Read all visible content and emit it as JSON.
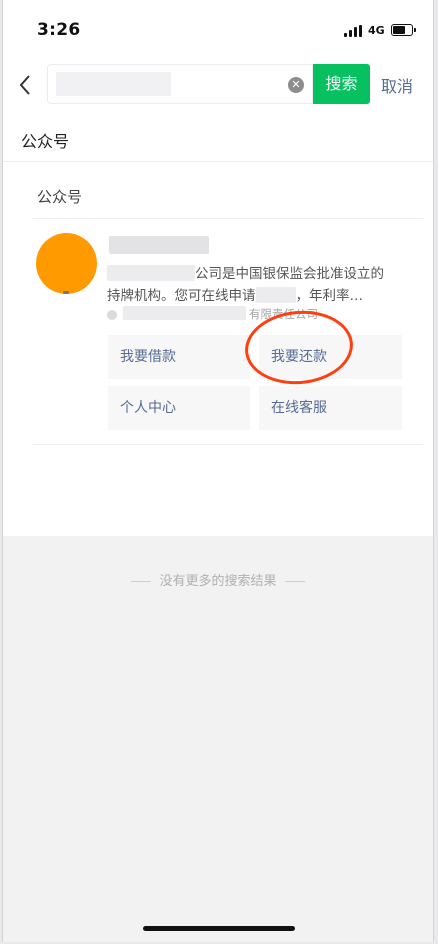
{
  "status_bar": {
    "time": "3:26",
    "network": "4G"
  },
  "search": {
    "button_label": "搜索",
    "cancel_label": "取消"
  },
  "section": {
    "label": "公众号",
    "group_title": "公众号"
  },
  "result": {
    "description_line1": "公司是中国银保监会批准设立的",
    "description_line2_part1": "持牌机构。您可在线申请",
    "description_line2_part2": "，年利率…",
    "meta_text": "有限责任公司",
    "menu": [
      {
        "label": "我要借款"
      },
      {
        "label": "我要还款"
      },
      {
        "label": "个人中心"
      },
      {
        "label": "在线客服"
      }
    ]
  },
  "footer": {
    "no_more_text": "没有更多的搜索结果"
  },
  "colors": {
    "brand_green": "#07c160",
    "link_blue": "#576b95",
    "avatar_orange": "#ff9b00",
    "annotation_red": "#ff3f0f"
  }
}
